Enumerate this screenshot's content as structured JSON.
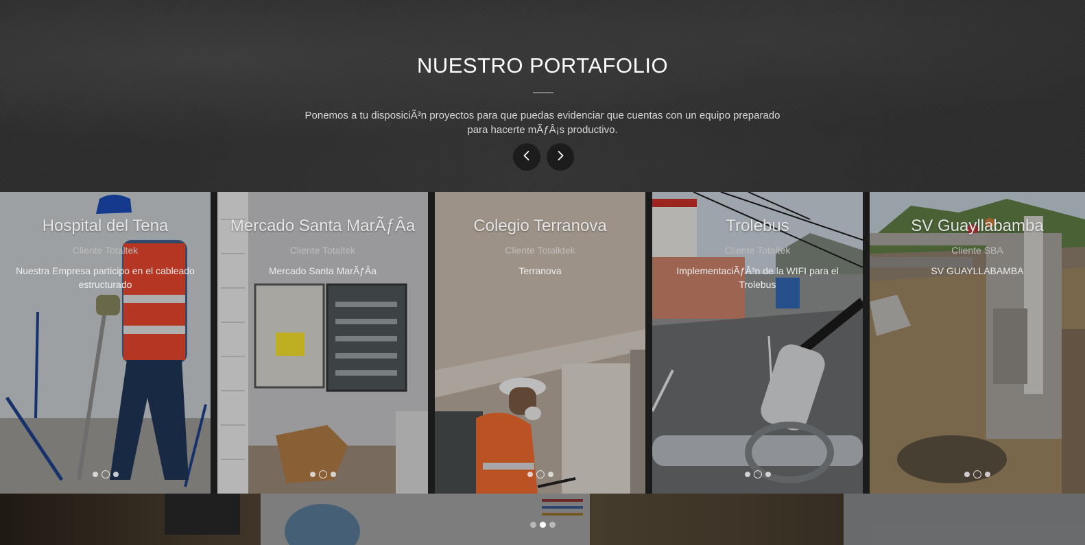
{
  "section": {
    "title": "NUESTRO PORTAFOLIO",
    "subtitle": "Ponemos a tu disposiciÃ³n proyectos para que puedas evidenciar que cuentas con un equipo preparado para hacerte mÃƒÂ¡s productivo.",
    "prev_icon": "chevron-left-icon",
    "next_icon": "chevron-right-icon"
  },
  "cards": [
    {
      "title": "Hospital del Tena",
      "client": "Cliente Totaltek",
      "description": "Nuestra Empresa participo en el cableado estructurado",
      "photo": "worker-with-helmet-and-vest",
      "dots_active": 2
    },
    {
      "title": "Mercado Santa MarÃƒÂa",
      "client": "Cliente Totaltek",
      "description": "Mercado Santa MarÃƒÂa",
      "photo": "electrical-panel",
      "dots_active": 2
    },
    {
      "title": "Colegio Terranova",
      "client": "Cliente Totalktek",
      "description": "Terranova",
      "photo": "worker-drilling-ceiling",
      "dots_active": 2
    },
    {
      "title": "Trolebus",
      "client": "Cliente Totaltek",
      "description": "ImplementaciÃƒÂ³n de la WIFI para el Trolebus",
      "photo": "street-antenna-mount",
      "dots_active": 2
    },
    {
      "title": "SV Guayllabamba",
      "client": "Cliente SBA",
      "description": "SV GUAYLLABAMBA",
      "photo": "construction-site-wall",
      "dots_active": 2
    }
  ],
  "pagination": {
    "count": 3,
    "active": 2
  },
  "colors": {
    "background": "#2e2e2e",
    "title": "#ffffff",
    "card_text": "#e6e6e6",
    "nav_button": "#1e1e1e"
  }
}
